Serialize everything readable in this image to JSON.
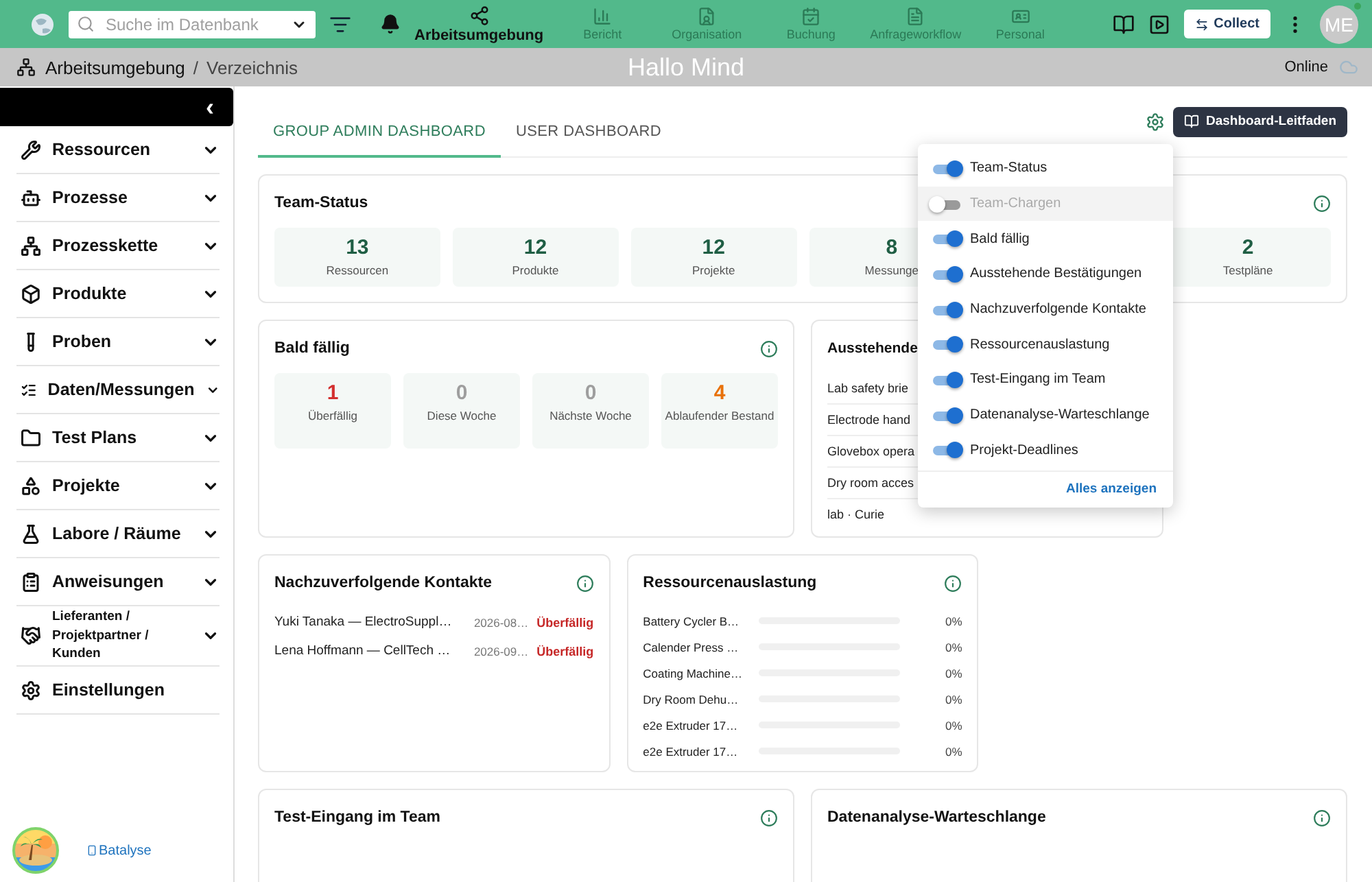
{
  "topbar": {
    "search": {
      "placeholder": "Suche im Datenbank"
    },
    "nav": [
      {
        "label": "Arbeitsumgebung",
        "selected": true
      },
      {
        "label": "Bericht",
        "selected": false
      },
      {
        "label": "Organisation",
        "selected": false
      },
      {
        "label": "Buchung",
        "selected": false
      },
      {
        "label": "Anfrageworkflow",
        "selected": false
      },
      {
        "label": "Personal",
        "selected": false
      }
    ],
    "collect": "Collect",
    "avatar": "ME"
  },
  "breadcrumb": {
    "items": [
      "Arbeitsumgebung",
      "Verzeichnis"
    ],
    "separator": "/",
    "greeting": "Hallo Mind",
    "status": "Online"
  },
  "sidebar": {
    "collapse": "‹",
    "items": [
      {
        "label": "Ressourcen",
        "expandable": true
      },
      {
        "label": "Prozesse",
        "expandable": true
      },
      {
        "label": "Prozesskette",
        "expandable": true
      },
      {
        "label": "Produkte",
        "expandable": true
      },
      {
        "label": "Proben",
        "expandable": true
      },
      {
        "label": "Daten/Messungen",
        "expandable": true
      },
      {
        "label": "Test Plans",
        "expandable": true
      },
      {
        "label": "Projekte",
        "expandable": true
      },
      {
        "label": "Labore / Räume",
        "expandable": true
      },
      {
        "label": "Anweisungen",
        "expandable": true
      },
      {
        "label": "Lieferanten / Projektpartner / Kunden",
        "expandable": true
      },
      {
        "label": "Einstellungen",
        "expandable": false
      }
    ],
    "footer_link": "Batalyse"
  },
  "tabs": [
    {
      "label": "GROUP ADMIN DASHBOARD",
      "selected": true
    },
    {
      "label": "USER DASHBOARD",
      "selected": false
    }
  ],
  "guide_button": "Dashboard-Leitfaden",
  "team_status": {
    "title": "Team-Status",
    "stats": [
      {
        "value": "13",
        "label": "Ressourcen"
      },
      {
        "value": "12",
        "label": "Produkte"
      },
      {
        "value": "12",
        "label": "Projekte"
      },
      {
        "value": "8",
        "label": "Messunge"
      },
      {
        "value": "2",
        "label": "Testpläne"
      }
    ]
  },
  "due": {
    "title": "Bald fällig",
    "stats": [
      {
        "value": "1",
        "label": "Überfällig",
        "color": "#d32f2f"
      },
      {
        "value": "0",
        "label": "Diese Woche",
        "color": "#9e9e9e"
      },
      {
        "value": "0",
        "label": "Nächste Woche",
        "color": "#9e9e9e"
      },
      {
        "value": "4",
        "label": "Ablaufender Bestand",
        "color": "#e8710a"
      }
    ]
  },
  "pending": {
    "title": "Ausstehende",
    "rows": [
      "Lab safety brie",
      "Electrode hand",
      "Glovebox opera",
      "Dry room acces",
      "lab · Curie"
    ]
  },
  "contacts": {
    "title": "Nachzuverfolgende Kontakte",
    "rows": [
      {
        "name": "Yuki Tanaka — ElectroSuppl…",
        "date": "2026-08…",
        "status": "Überfällig"
      },
      {
        "name": "Lena Hoffmann — CellTech …",
        "date": "2026-09…",
        "status": "Überfällig"
      }
    ]
  },
  "utilization": {
    "title": "Ressourcenauslastung",
    "rows": [
      {
        "name": "Battery Cycler B…",
        "level": 0,
        "reading": "0%"
      },
      {
        "name": "Calender Press …",
        "level": 0,
        "reading": "0%"
      },
      {
        "name": "Coating Machine…",
        "level": 0,
        "reading": "0%"
      },
      {
        "name": "Dry Room Dehu…",
        "level": 0,
        "reading": "0%"
      },
      {
        "name": "e2e Extruder 17…",
        "level": 0,
        "reading": "0%"
      },
      {
        "name": "e2e Extruder 17…",
        "level": 0,
        "reading": "0%"
      }
    ]
  },
  "bottom_cards": [
    {
      "title": "Test-Eingang im Team"
    },
    {
      "title": "Datenanalyse-Warteschlange"
    }
  ],
  "widget_menu": {
    "items": [
      {
        "label": "Team-Status",
        "on": true,
        "selected": false
      },
      {
        "label": "Team-Chargen",
        "on": false,
        "selected": true
      },
      {
        "label": "Bald fällig",
        "on": true,
        "selected": false
      },
      {
        "label": "Ausstehende Bestätigungen",
        "on": true,
        "selected": false
      },
      {
        "label": "Nachzuverfolgende Kontakte",
        "on": true,
        "selected": false
      },
      {
        "label": "Ressourcenauslastung",
        "on": true,
        "selected": false
      },
      {
        "label": "Test-Eingang im Team",
        "on": true,
        "selected": false
      },
      {
        "label": "Datenanalyse-Warteschlange",
        "on": true,
        "selected": false
      },
      {
        "label": "Projekt-Deadlines",
        "on": true,
        "selected": false
      }
    ],
    "link": "Alles anzeigen"
  }
}
